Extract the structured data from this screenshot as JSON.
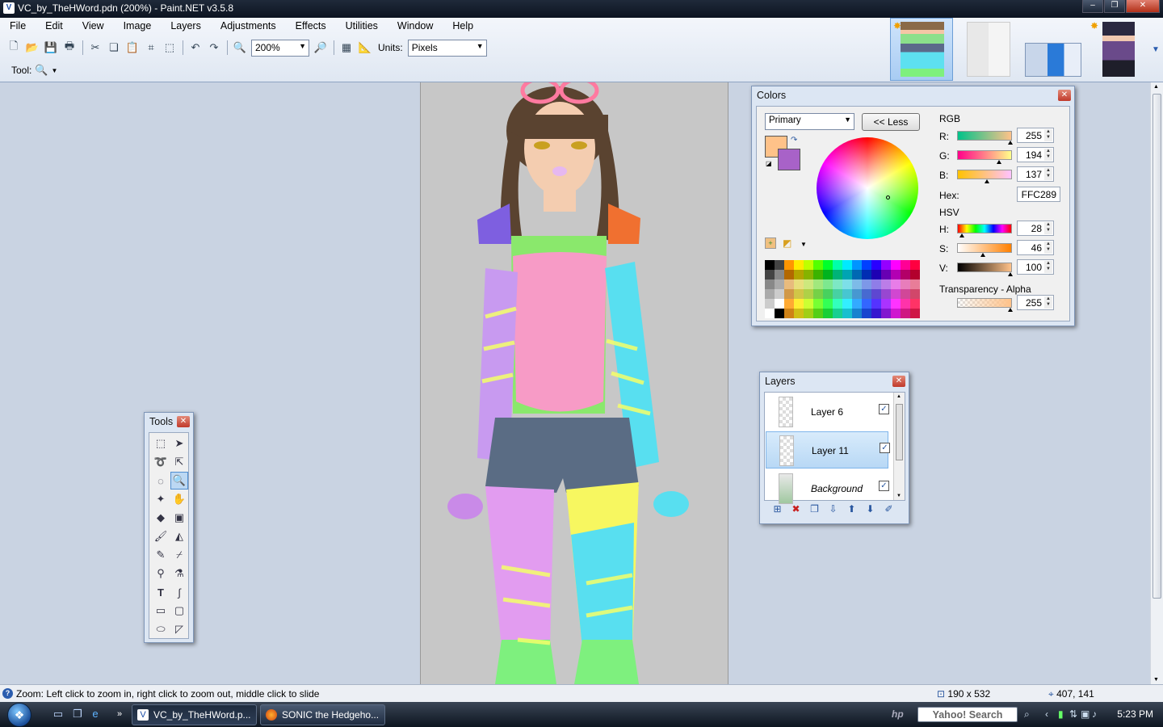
{
  "window": {
    "title": "VC_by_TheHWord.pdn (200%) - Paint.NET v3.5.8",
    "app_icon": "paintdotnet-icon",
    "controls": [
      "minimize",
      "maximize",
      "close"
    ]
  },
  "menu": [
    "File",
    "Edit",
    "View",
    "Image",
    "Layers",
    "Adjustments",
    "Effects",
    "Utilities",
    "Window",
    "Help"
  ],
  "toolbar": {
    "zoom_value": "200%",
    "units_label": "Units:",
    "units_value": "Pixels",
    "tool_label": "Tool:",
    "icons": [
      "new-icon",
      "open-icon",
      "save-icon",
      "print-icon",
      "cut-icon",
      "copy-icon",
      "paste-icon",
      "crop-icon",
      "deselect-icon",
      "undo-icon",
      "redo-icon",
      "zoom-out-icon",
      "zoom-in-icon",
      "grid-icon",
      "ruler-icon"
    ]
  },
  "thumbnails": [
    {
      "selected": true,
      "starred": true
    },
    {
      "selected": false,
      "starred": false
    },
    {
      "selected": false,
      "starred": false
    },
    {
      "selected": false,
      "starred": true
    }
  ],
  "tools_window": {
    "title": "Tools",
    "tools": [
      "rectangle-select",
      "move-selected-pixels",
      "lasso-select",
      "move-selection",
      "ellipse-select",
      "zoom",
      "magic-wand",
      "pan",
      "paint-bucket",
      "gradient",
      "paintbrush",
      "eraser",
      "pencil",
      "color-picker",
      "clone-stamp",
      "recolor",
      "text",
      "line-curve",
      "rectangle",
      "rounded-rectangle",
      "ellipse",
      "freeform-shape"
    ],
    "selected_tool": "zoom"
  },
  "colors_window": {
    "title": "Colors",
    "mode": "Primary",
    "less_button": "<< Less",
    "rgb_label": "RGB",
    "r_label": "R:",
    "r": "255",
    "g_label": "G:",
    "g": "194",
    "b_label": "B:",
    "b": "137",
    "hex_label": "Hex:",
    "hex": "FFC289",
    "hsv_label": "HSV",
    "h_label": "H:",
    "h": "28",
    "s_label": "S:",
    "s": "46",
    "v_label": "V:",
    "v": "100",
    "alpha_label": "Transparency - Alpha",
    "alpha": "255",
    "primary_color": "#FFC289",
    "secondary_color": "#A862C8"
  },
  "layers_window": {
    "title": "Layers",
    "layers": [
      {
        "name": "Layer 6",
        "visible": true,
        "selected": false
      },
      {
        "name": "Layer 11",
        "visible": true,
        "selected": true
      },
      {
        "name": "Background",
        "visible": true,
        "selected": false
      }
    ],
    "buttons": [
      "add-layer",
      "delete-layer",
      "duplicate-layer",
      "merge-down",
      "move-up",
      "move-down",
      "layer-properties"
    ]
  },
  "statusbar": {
    "hint": "Zoom: Left click to zoom in, right click to zoom out, middle click to slide",
    "image_size": "190 x 532",
    "cursor_pos": "407, 141"
  },
  "taskbar": {
    "tasks": [
      {
        "label": "VC_by_TheHWord.p...",
        "icon": "paintdotnet-icon",
        "active": true
      },
      {
        "label": "SONIC the Hedgeho...",
        "icon": "firefox-icon",
        "active": false
      }
    ],
    "search_label": "Yahoo! Search",
    "clock": "5:23 PM"
  }
}
